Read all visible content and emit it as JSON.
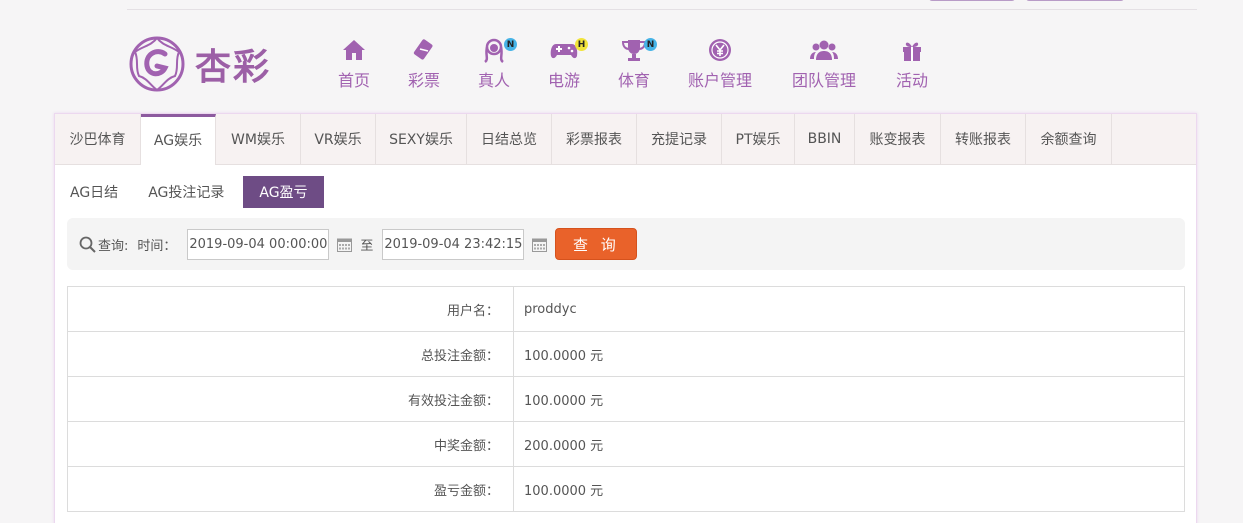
{
  "brand": {
    "name": "杏彩"
  },
  "nav": [
    {
      "label": "首页",
      "icon": "home-icon",
      "badge": ""
    },
    {
      "label": "彩票",
      "icon": "ticket-icon",
      "badge": ""
    },
    {
      "label": "真人",
      "icon": "dealer-icon",
      "badge": "N"
    },
    {
      "label": "电游",
      "icon": "gamepad-icon",
      "badge": "H"
    },
    {
      "label": "体育",
      "icon": "trophy-icon",
      "badge": "N"
    },
    {
      "label": "账户管理",
      "icon": "yen-icon",
      "badge": ""
    },
    {
      "label": "团队管理",
      "icon": "team-icon",
      "badge": ""
    },
    {
      "label": "活动",
      "icon": "gift-icon",
      "badge": ""
    }
  ],
  "tabs": [
    "沙巴体育",
    "AG娱乐",
    "WM娱乐",
    "VR娱乐",
    "SEXY娱乐",
    "日结总览",
    "彩票报表",
    "充提记录",
    "PT娱乐",
    "BBIN",
    "账变报表",
    "转账报表",
    "余额查询"
  ],
  "active_tab": "AG娱乐",
  "subtabs": [
    "AG日结",
    "AG投注记录",
    "AG盈亏"
  ],
  "active_subtab": "AG盈亏",
  "search": {
    "query_label": "查询:",
    "time_label": "时间：",
    "start": "2019-09-04 00:00:00",
    "to_label": "至",
    "end": "2019-09-04 23:42:15",
    "button": "查 询"
  },
  "summary": [
    {
      "label": "用户名：",
      "value": "proddyc"
    },
    {
      "label": "总投注金额：",
      "value": "100.0000 元"
    },
    {
      "label": "有效投注金额：",
      "value": "100.0000 元"
    },
    {
      "label": "中奖金额：",
      "value": "200.0000 元"
    },
    {
      "label": "盈亏金额：",
      "value": "100.0000 元"
    }
  ],
  "colors": {
    "brand": "#a162b0",
    "active_sub": "#6e4c85",
    "query_button": "#e9622a"
  }
}
